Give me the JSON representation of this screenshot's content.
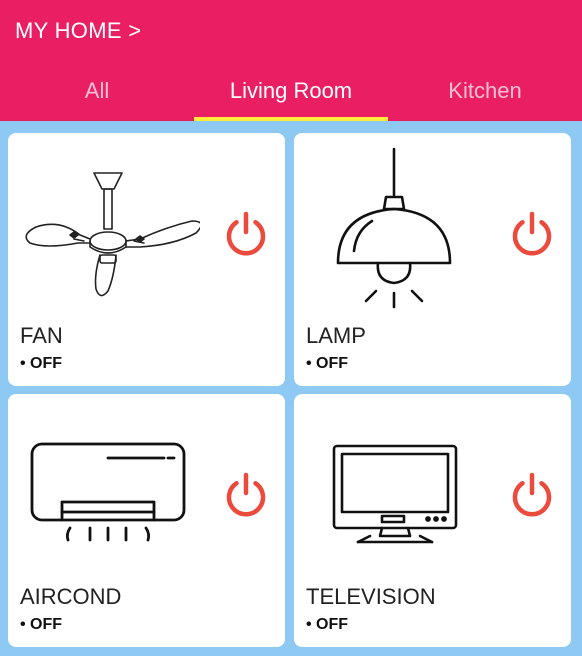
{
  "header": {
    "title": "MY HOME >"
  },
  "tabs": [
    {
      "label": "All"
    },
    {
      "label": "Living Room"
    },
    {
      "label": "Kitchen"
    }
  ],
  "devices": [
    {
      "name": "FAN",
      "status": "• OFF",
      "icon": "ceiling-fan-icon"
    },
    {
      "name": "LAMP",
      "status": "• OFF",
      "icon": "pendant-lamp-icon"
    },
    {
      "name": "AIRCOND",
      "status": "• OFF",
      "icon": "air-conditioner-icon"
    },
    {
      "name": "TELEVISION",
      "status": "• OFF",
      "icon": "television-icon"
    }
  ],
  "colors": {
    "appbar": "#e91e63",
    "tab_indicator": "#ffeb3b",
    "background": "#8ec9f4",
    "power_icon": "#ec4a3d"
  }
}
